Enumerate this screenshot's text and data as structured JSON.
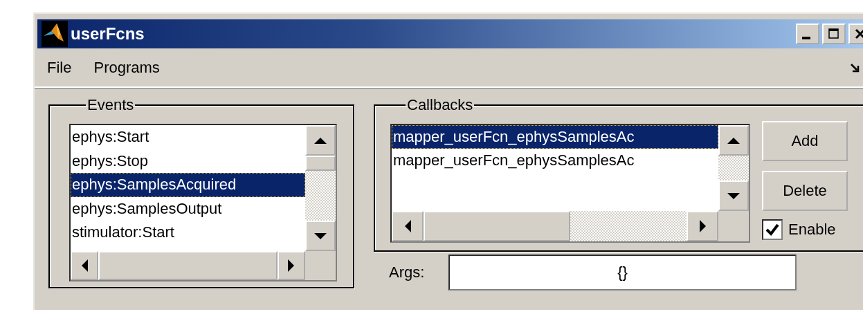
{
  "window": {
    "title": "userFcns"
  },
  "menu": [
    {
      "label": "File"
    },
    {
      "label": "Programs"
    }
  ],
  "events": {
    "title": "Events",
    "items": [
      {
        "label": "ephys:Start",
        "selected": false
      },
      {
        "label": "ephys:Stop",
        "selected": false
      },
      {
        "label": "ephys:SamplesAcquired",
        "selected": true
      },
      {
        "label": "ephys:SamplesOutput",
        "selected": false
      },
      {
        "label": "stimulator:Start",
        "selected": false
      }
    ]
  },
  "callbacks": {
    "title": "Callbacks",
    "items": [
      {
        "label": "mapper_userFcn_ephysSamplesAc",
        "selected": true
      },
      {
        "label": "mapper_userFcn_ephysSamplesAc",
        "selected": false
      }
    ]
  },
  "buttons": [
    {
      "label": "Add"
    },
    {
      "label": "Delete"
    }
  ],
  "enable": {
    "label": "Enable",
    "checked": true
  },
  "args": {
    "label": "Args:",
    "value": "{}"
  }
}
